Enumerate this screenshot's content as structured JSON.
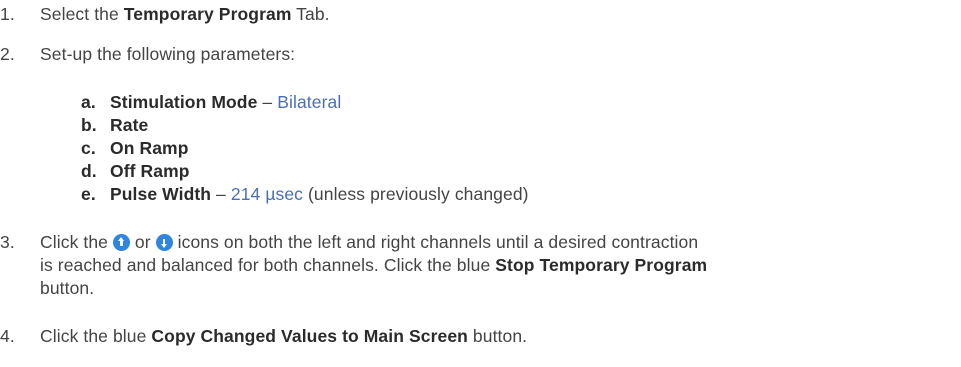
{
  "steps": [
    {
      "num": "1.",
      "pre": "Select the ",
      "bold": "Temporary Program",
      "post": " Tab."
    },
    {
      "num": "2.",
      "text": "Set-up the following parameters:"
    },
    {
      "num": "3.",
      "pre": "Click the ",
      "mid": " or ",
      "post": " icons on both the left and right channels until a desired contraction",
      "line2_pre": "is reached and balanced for both channels. Click the blue ",
      "line2_bold": "Stop Temporary Program",
      "line3": "button."
    },
    {
      "num": "4.",
      "pre": "Click the blue ",
      "bold": "Copy Changed Values to Main Screen",
      "post": " button."
    }
  ],
  "params": [
    {
      "letter": "a.",
      "label": "Stimulation Mode",
      "sep": " – ",
      "value": "Bilateral",
      "note": ""
    },
    {
      "letter": "b.",
      "label": "Rate"
    },
    {
      "letter": "c.",
      "label": "On Ramp"
    },
    {
      "letter": "d.",
      "label": "Off Ramp"
    },
    {
      "letter": "e.",
      "label": "Pulse Width",
      "sep": " – ",
      "value": "214 µsec",
      "note": " (unless previously changed)"
    }
  ],
  "icons": {
    "up": "arrow-up-circle-icon",
    "down": "arrow-down-circle-icon",
    "color": "#2e86de"
  }
}
